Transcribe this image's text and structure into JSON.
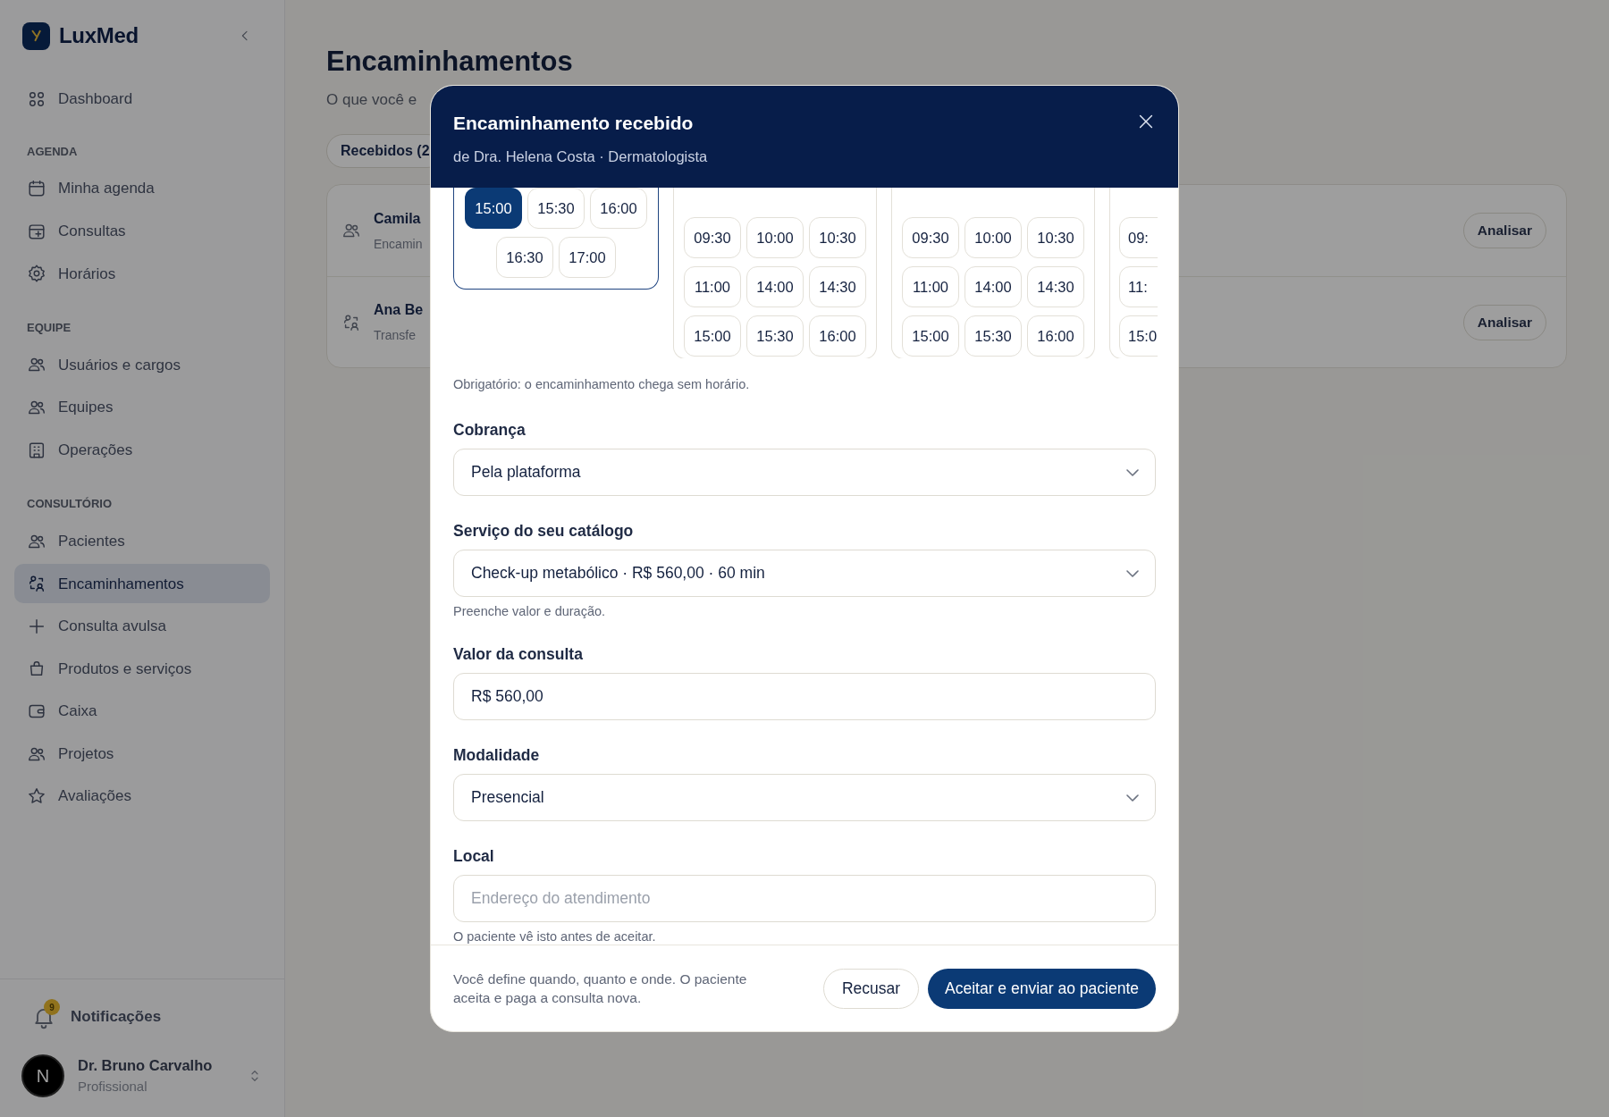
{
  "sidebar": {
    "brand": "LuxMed",
    "nav": [
      {
        "items": [
          {
            "label": "Dashboard",
            "selected": false
          }
        ]
      },
      {
        "title": "AGENDA",
        "items": [
          {
            "label": "Minha agenda",
            "selected": false
          },
          {
            "label": "Consultas",
            "selected": false
          },
          {
            "label": "Horários",
            "selected": false
          }
        ]
      },
      {
        "title": "EQUIPE",
        "items": [
          {
            "label": "Usuários e cargos",
            "selected": false
          },
          {
            "label": "Equipes",
            "selected": false
          },
          {
            "label": "Operações",
            "selected": false
          }
        ]
      },
      {
        "title": "CONSULTÓRIO",
        "items": [
          {
            "label": "Pacientes",
            "selected": false
          },
          {
            "label": "Encaminhamentos",
            "selected": true
          },
          {
            "label": "Consulta avulsa",
            "selected": false
          },
          {
            "label": "Produtos e serviços",
            "selected": false
          },
          {
            "label": "Caixa",
            "selected": false
          },
          {
            "label": "Projetos",
            "selected": false
          },
          {
            "label": "Avaliações",
            "selected": false
          }
        ]
      }
    ],
    "notifications": {
      "label": "Notificações",
      "count": "9"
    },
    "user": {
      "initial": "N",
      "name": "Dr. Bruno Carvalho",
      "role": "Profissional"
    }
  },
  "main": {
    "title": "Encaminhamentos",
    "subtitle": "O que você e",
    "tabs": [
      {
        "label": "Recebidos (2",
        "selected": true
      }
    ],
    "rows": [
      {
        "name": "Camila",
        "detail": "Encamin",
        "action": "Analisar"
      },
      {
        "name": "Ana Be",
        "detail": "Transfe",
        "action": "Analisar"
      }
    ]
  },
  "modal": {
    "title": "Encaminhamento recebido",
    "subtitle": "de Dra. Helena Costa · Dermatologista",
    "slot_days": [
      {
        "kind": "full",
        "selected": true,
        "slots": [
          {
            "time": "15:00",
            "selected": true
          },
          {
            "time": "15:30",
            "selected": false
          },
          {
            "time": "16:00",
            "selected": false
          },
          {
            "time": "16:30",
            "selected": false
          },
          {
            "time": "17:00",
            "selected": false
          }
        ]
      },
      {
        "kind": "full",
        "selected": false,
        "slots": [
          {
            "time": "09:30",
            "selected": false
          },
          {
            "time": "10:00",
            "selected": false
          },
          {
            "time": "10:30",
            "selected": false
          },
          {
            "time": "11:00",
            "selected": false
          },
          {
            "time": "14:00",
            "selected": false
          },
          {
            "time": "14:30",
            "selected": false
          },
          {
            "time": "15:00",
            "selected": false
          },
          {
            "time": "15:30",
            "selected": false
          },
          {
            "time": "16:00",
            "selected": false
          }
        ]
      },
      {
        "kind": "full",
        "selected": false,
        "slots": [
          {
            "time": "09:30",
            "selected": false
          },
          {
            "time": "10:00",
            "selected": false
          },
          {
            "time": "10:30",
            "selected": false
          },
          {
            "time": "11:00",
            "selected": false
          },
          {
            "time": "14:00",
            "selected": false
          },
          {
            "time": "14:30",
            "selected": false
          },
          {
            "time": "15:00",
            "selected": false
          },
          {
            "time": "15:30",
            "selected": false
          },
          {
            "time": "16:00",
            "selected": false
          }
        ]
      },
      {
        "kind": "partial",
        "selected": false,
        "slots": [
          {
            "time": "09:",
            "selected": false
          },
          {
            "time": "11:",
            "selected": false
          },
          {
            "time": "15:0",
            "selected": false
          }
        ]
      }
    ],
    "slots_note": "Obrigatório: o encaminhamento chega sem horário.",
    "fields": [
      {
        "kind": "select",
        "label": "Cobrança",
        "value": "Pela plataforma"
      },
      {
        "kind": "select",
        "label": "Serviço do seu catálogo",
        "value": "Check-up metabólico · R$ 560,00 · 60 min",
        "hint": "Preenche valor e duração."
      },
      {
        "kind": "input",
        "label": "Valor da consulta",
        "value": "R$ 560,00"
      },
      {
        "kind": "select",
        "label": "Modalidade",
        "value": "Presencial"
      },
      {
        "kind": "input",
        "label": "Local",
        "placeholder": "Endereço do atendimento",
        "hint": "O paciente vê isto antes de aceitar."
      }
    ],
    "footer_note": "Você define quando, quanto e onde. O paciente aceita e paga a consulta nova.",
    "buttons": [
      {
        "kind": "secondary",
        "label": "Recusar"
      },
      {
        "kind": "primary",
        "label": "Aceitar e enviar ao paciente"
      }
    ]
  }
}
